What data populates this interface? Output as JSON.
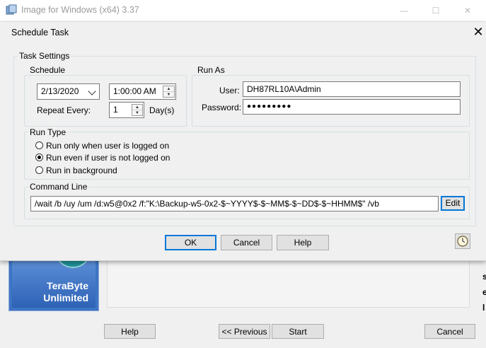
{
  "main_window": {
    "title": "Image for Windows (x64) 3.37",
    "controls": {
      "minimize": "—",
      "maximize": "☐",
      "close": "✕"
    },
    "logo": {
      "line1": "TeraByte",
      "line2": "Unlimited"
    },
    "buttons": {
      "help": "Help",
      "previous": "<< Previous",
      "start": "Start",
      "cancel": "Cancel"
    },
    "edge_marks": [
      "s",
      "e",
      "l"
    ]
  },
  "dialog": {
    "title": "Schedule Task",
    "close": "✕",
    "task_settings": {
      "label": "Task Settings",
      "schedule": {
        "label": "Schedule",
        "date": "2/13/2020",
        "time": "1:00:00 AM",
        "repeat_label": "Repeat Every:",
        "repeat_value": "1",
        "repeat_unit": "Day(s)"
      },
      "run_as": {
        "label": "Run As",
        "user_label": "User:",
        "user_value": "DH87RL10A\\Admin",
        "password_label": "Password:",
        "password_value": "●●●●●●●●●"
      }
    },
    "run_type": {
      "label": "Run Type",
      "options": [
        {
          "label": "Run only when user is logged on",
          "checked": false
        },
        {
          "label": "Run even if user is not logged on",
          "checked": true
        },
        {
          "label": "Run in background",
          "checked": false
        }
      ]
    },
    "command_line": {
      "label": "Command Line",
      "value": "/wait /b /uy /um /d:w5@0x2 /f:\"K:\\Backup-w5-0x2-$~YYYY$-$~MM$-$~DD$-$~HHMM$\" /vb",
      "edit_button": "Edit"
    },
    "buttons": {
      "ok": "OK",
      "cancel": "Cancel",
      "help": "Help"
    },
    "icons": {
      "clock": "clock-icon"
    },
    "colors": {
      "accent": "#0078d7"
    }
  }
}
